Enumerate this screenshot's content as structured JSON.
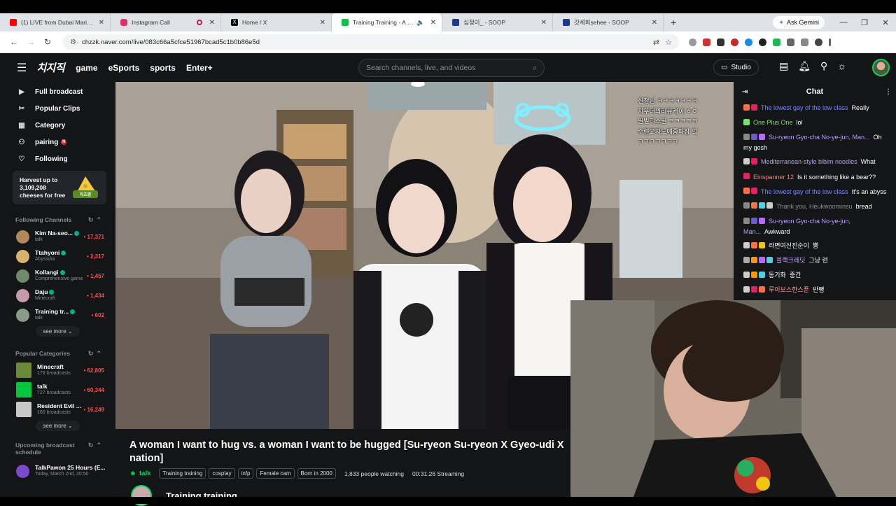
{
  "browser": {
    "tabs": [
      {
        "title": "(1) LIVE from Dubai Marina - Te",
        "color": "#ff0000"
      },
      {
        "title": "Instagram Call",
        "color": "#e1306c"
      },
      {
        "title": "Home / X",
        "color": "#000000"
      },
      {
        "title": "Training Training - A woma",
        "color": "#00c73c",
        "active": true
      },
      {
        "title": "심정이_ - SOOP",
        "color": "#1e3a8a"
      },
      {
        "title": "갓세희sehee - SOOP",
        "color": "#1e3a8a"
      }
    ],
    "new_tab": "+",
    "ask_gemini": "Ask Gemini",
    "window_controls": [
      "—",
      "❐",
      "✕"
    ],
    "url": "chzzk.naver.com/live/083c66a5cfce51967bcad5c1b0b86e5d"
  },
  "site": {
    "logo": "치지직",
    "nav": [
      "game",
      "eSports",
      "sports",
      "Enter+"
    ],
    "search_placeholder": "Search channels, live, and videos",
    "studio_label": "Studio"
  },
  "sidebar": {
    "nav": [
      {
        "label": "Full broadcast",
        "icon": "broadcast-icon",
        "glyph": "▶"
      },
      {
        "label": "Popular Clips",
        "icon": "clips-icon",
        "glyph": "✂"
      },
      {
        "label": "Category",
        "icon": "category-icon",
        "glyph": "▦"
      },
      {
        "label": "pairing",
        "icon": "pairing-icon",
        "glyph": "⚇",
        "badge": "N"
      },
      {
        "label": "Following",
        "icon": "heart-icon",
        "glyph": "♡"
      }
    ],
    "promo": {
      "line1": "Harvest up to",
      "line2": "3,109,208",
      "line3": "cheeses for free",
      "badge": "치즈팜"
    },
    "following_title": "Following Channels",
    "following": [
      {
        "name": "Kim Na-seo...",
        "sub": "talk",
        "count": "17,371",
        "color": "#b0885a"
      },
      {
        "name": "Ttahyoni",
        "sub": "Abyssdia",
        "count": "2,317",
        "color": "#d7b26a"
      },
      {
        "name": "Kollangi",
        "sub": "Comprehensive game",
        "count": "1,457",
        "color": "#6e8a6a"
      },
      {
        "name": "Daju",
        "sub": "Minecraft",
        "count": "1,434",
        "color": "#c79aa8"
      },
      {
        "name": "Training tr...",
        "sub": "talk",
        "count": "602",
        "color": "#8a9a8a"
      }
    ],
    "see_more": "see more ⌄",
    "categories_title": "Popular Categories",
    "categories": [
      {
        "name": "Minecraft",
        "sub": "178 broadcasts",
        "count": "62,805",
        "color": "#6a8a3a"
      },
      {
        "name": "talk",
        "sub": "727 broadcasts",
        "count": "60,344",
        "color": "#00c73c"
      },
      {
        "name": "Resident Evil ...",
        "sub": "160 broadcasts",
        "count": "16,249",
        "color": "#c8c8c8"
      }
    ],
    "upcoming_title": "Upcoming broadcast schedule",
    "upcoming": {
      "name": "TalkPawon 25 Hours (E...",
      "sub": "Today, March 2nd, 20:50"
    }
  },
  "overlay_chat": [
    "신청님 ㅋㅋㅋㅋㅋㅋㅋ",
    "지우더의리큐케이 ㅎㅇ",
    "원빌리스원 ㅋㅋㅋㅋㅋ",
    "수련교자노예중파장 엌",
    "ㅋㅋㅋㅋㅋㅋㅋ"
  ],
  "chat": {
    "title": "Chat",
    "messages": [
      {
        "nick": "The lowest gay of the low class",
        "text": "Really",
        "nick_color": "#7e8cf8"
      },
      {
        "nick": "One Plus One",
        "text": "lol",
        "nick_color": "#7ce36a"
      },
      {
        "nick": "Su-ryeon Gyo-cha No-ye-jun, Man...",
        "text": "Oh my gosh",
        "nick_color": "#b8a2ff"
      },
      {
        "nick": "Mediterranean-style bibim noodles",
        "text": "What",
        "nick_color": "#b8a2ff"
      },
      {
        "nick": "Einspanner 12",
        "text": "Is it something like a bear??",
        "nick_color": "#ff7b7b"
      },
      {
        "nick": "The lowest gay of the low class",
        "text": "It's an abyss",
        "nick_color": "#7e8cf8"
      },
      {
        "nick": "Thank you, Heukwoominsu",
        "text": "bread",
        "nick_color": "#8a8d93"
      },
      {
        "nick": "Su-ryeon Gyo-cha No-ye-jun, Man...",
        "text": "Awkward",
        "nick_color": "#b8a2ff"
      },
      {
        "nick": "라면여신진순이",
        "text": "뿡",
        "nick_color": "#ffffff"
      },
      {
        "nick": "블랙크레딧",
        "text": "그냥 련",
        "nick_color": "#c8a2ff"
      },
      {
        "nick": "동기화",
        "text": "중간",
        "nick_color": "#ffffff"
      },
      {
        "nick": "루이보스한스푼",
        "text": "반뼝",
        "nick_color": "#ff9a9a"
      }
    ]
  },
  "stream": {
    "title": "A woman I want to hug vs. a woman I want to be hugged [Su-ryeon Su-ryeon X Gyeo-udi X",
    "title_line2": "nation]",
    "category": "talk",
    "tags": [
      "Training training",
      "cosplay",
      "infp",
      "Female cam",
      "Born in 2000"
    ],
    "watching": "1,833 people watching",
    "uptime": "00:31:26 Streaming",
    "streamer": "Training training"
  }
}
